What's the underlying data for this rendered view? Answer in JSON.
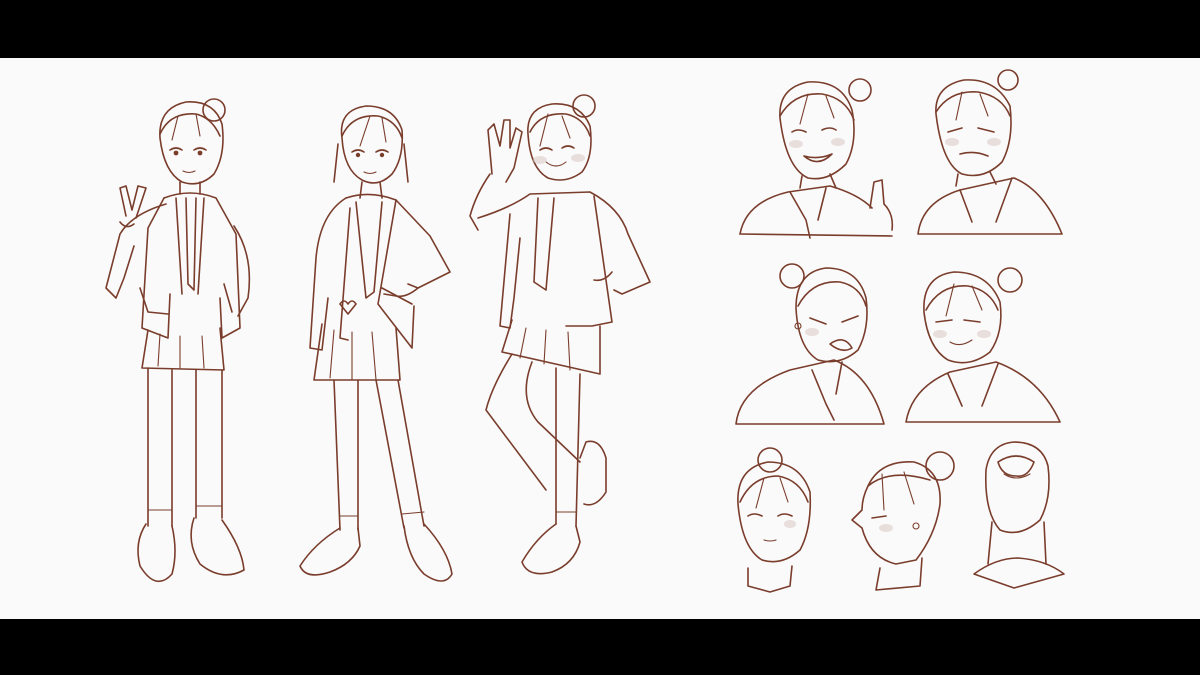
{
  "image": {
    "subject": "character-sketch",
    "colors": {
      "letterbox": "#000000",
      "paper": "#fafafa",
      "ink": "#7a3d2c",
      "ink_light": "#b58a7c",
      "blush": "#d9c9c4"
    }
  }
}
